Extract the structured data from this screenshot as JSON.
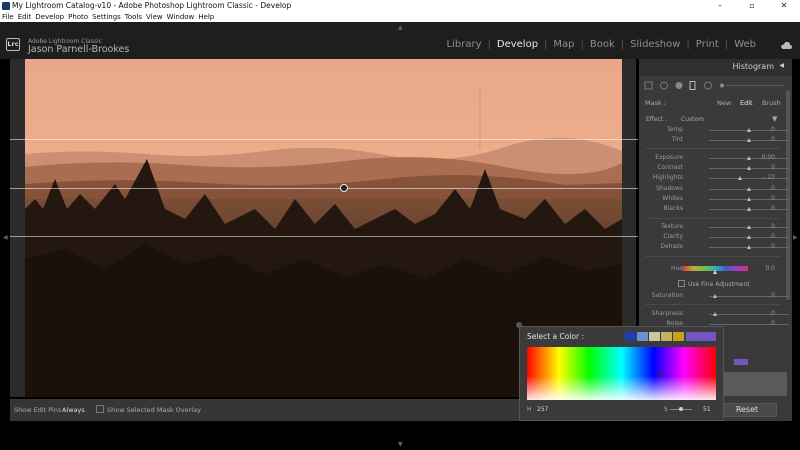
{
  "window": {
    "title": "My Lightroom Catalog-v10 - Adobe Photoshop Lightroom Classic - Develop",
    "controls": [
      "–",
      "▫",
      "✕"
    ]
  },
  "menu": [
    "File",
    "Edit",
    "Develop",
    "Photo",
    "Settings",
    "Tools",
    "View",
    "Window",
    "Help"
  ],
  "identity": {
    "logo": "Lrc",
    "line1": "Adobe Lightroom Classic",
    "line2": "Jason Parnell-Brookes"
  },
  "modules": [
    {
      "label": "Library",
      "active": false
    },
    {
      "label": "Develop",
      "active": true
    },
    {
      "label": "Map",
      "active": false
    },
    {
      "label": "Book",
      "active": false
    },
    {
      "label": "Slideshow",
      "active": false
    },
    {
      "label": "Print",
      "active": false
    },
    {
      "label": "Web",
      "active": false
    }
  ],
  "toolbar": {
    "show_edit_pins_label": "Show Edit Pins :",
    "show_edit_pins_value": "Always",
    "show_overlay_label": "Show Selected Mask Overlay"
  },
  "panel": {
    "histogram_label": "Histogram",
    "mask_label": "Mask :",
    "mask_new": "New",
    "mask_edit": "Edit",
    "mask_brush": "Brush",
    "effect_label": "Effect :",
    "effect_value": "Custom",
    "sliders": [
      {
        "label": "Temp",
        "value": "0",
        "pos": 0.5
      },
      {
        "label": "Tint",
        "value": "0",
        "pos": 0.5
      },
      {
        "label": "Exposure",
        "value": "0.00",
        "pos": 0.5
      },
      {
        "label": "Contrast",
        "value": "0",
        "pos": 0.5
      },
      {
        "label": "Highlights",
        "value": "– 22",
        "pos": 0.39
      },
      {
        "label": "Shadows",
        "value": "0",
        "pos": 0.5
      },
      {
        "label": "Whites",
        "value": "0",
        "pos": 0.5
      },
      {
        "label": "Blacks",
        "value": "0",
        "pos": 0.5
      },
      {
        "label": "Texture",
        "value": "0",
        "pos": 0.5
      },
      {
        "label": "Clarity",
        "value": "0",
        "pos": 0.5
      },
      {
        "label": "Dehaze",
        "value": "0",
        "pos": 0.5
      }
    ],
    "hue_label": "Hue",
    "hue_value": "0.0",
    "fine_adjustment": "Use Fine Adjustment",
    "saturation_label": "Saturation",
    "saturation_value": "0",
    "sharpness_label": "Sharpness",
    "sharpness_value": "0",
    "noise_label": "Noise",
    "noise_value": "0",
    "reset_label": "Reset"
  },
  "color_picker": {
    "title": "Select a Color :",
    "swatches": [
      "#1f3fb0",
      "#6d8fd0",
      "#c9c9a0",
      "#c7b060",
      "#c8a020"
    ],
    "current_color": "#7356c2",
    "h_label": "H",
    "h_value": "257",
    "s_label": "S",
    "s_value": "51",
    "s_level": 0.51
  }
}
